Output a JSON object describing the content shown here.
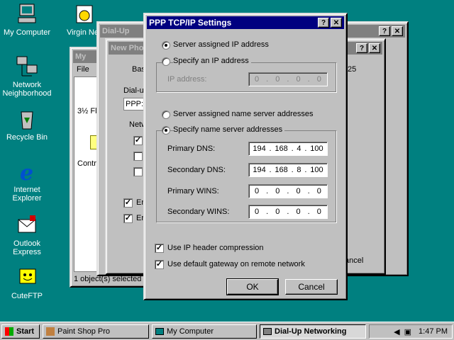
{
  "desktop": {
    "icons": [
      {
        "label": "My Computer",
        "icon": "computer-icon"
      },
      {
        "label": "Virgin Net",
        "icon": "phone-icon"
      },
      {
        "label": "Network Neighborhood",
        "icon": "network-icon"
      },
      {
        "label": "Recycle Bin",
        "icon": "recycle-bin-icon"
      },
      {
        "label": "Internet Explorer",
        "icon": "ie-icon"
      },
      {
        "label": "Outlook Express",
        "icon": "outlook-icon"
      },
      {
        "label": "CuteFTP",
        "icon": "cuteftp-icon"
      }
    ]
  },
  "bg_windows": {
    "dialup_title": "Dial-Up",
    "mycomp_title": "My",
    "newphone_title": "New Pho",
    "tab_basic": "Basi",
    "tab_25": "25",
    "menu_file": "File",
    "drive_label": "3½ Fl",
    "control_label": "Contr",
    "dialup_label": "Dial-up",
    "ppp_value": "PPP:",
    "network_label": "Netw",
    "enable1": "Er",
    "enable2": "Er",
    "status_bar": "1 object(s) selected",
    "cancel_partial": "ancel"
  },
  "dialog": {
    "title": "PPP TCP/IP Settings",
    "radio_server_ip": "Server assigned IP address",
    "radio_specify_ip": "Specify an IP address",
    "ip_address_label": "IP address:",
    "ip_address": [
      "0",
      "0",
      "0",
      "0"
    ],
    "radio_server_ns": "Server assigned name server addresses",
    "radio_specify_ns": "Specify name server addresses",
    "primary_dns_label": "Primary DNS:",
    "primary_dns": [
      "194",
      "168",
      "4",
      "100"
    ],
    "secondary_dns_label": "Secondary DNS:",
    "secondary_dns": [
      "194",
      "168",
      "8",
      "100"
    ],
    "primary_wins_label": "Primary WINS:",
    "primary_wins": [
      "0",
      "0",
      "0",
      "0"
    ],
    "secondary_wins_label": "Secondary WINS:",
    "secondary_wins": [
      "0",
      "0",
      "0",
      "0"
    ],
    "use_ip_header": "Use IP header compression",
    "use_default_gateway": "Use default gateway on remote network",
    "ok": "OK",
    "cancel": "Cancel",
    "help_btn": "?",
    "close_btn": "✕"
  },
  "taskbar": {
    "start": "Start",
    "tasks": [
      {
        "label": "Paint Shop Pro",
        "pressed": false
      },
      {
        "label": "My Computer",
        "pressed": false
      },
      {
        "label": "Dial-Up Networking",
        "pressed": true
      }
    ],
    "clock": "1:47 PM"
  }
}
